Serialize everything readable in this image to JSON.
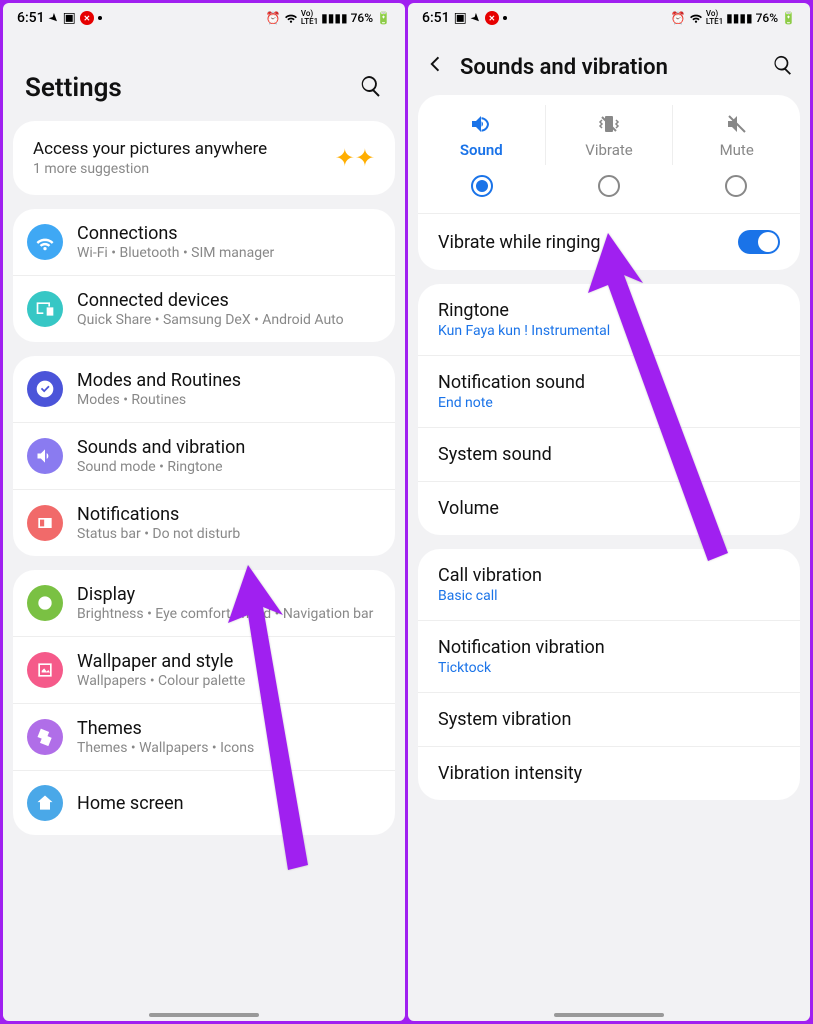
{
  "status": {
    "time": "6:51",
    "battery": "76%",
    "net": "LTE1",
    "vo": "VoLTE"
  },
  "left": {
    "title": "Settings",
    "suggest_title": "Access your pictures anywhere",
    "suggest_sub": "1 more suggestion",
    "groups": [
      [
        {
          "icon": "wifi",
          "bg": "#3fa8f4",
          "title": "Connections",
          "sub": "Wi-Fi  •  Bluetooth  •  SIM manager"
        },
        {
          "icon": "devices",
          "bg": "#37c7c5",
          "title": "Connected devices",
          "sub": "Quick Share  •  Samsung DeX  •  Android Auto"
        }
      ],
      [
        {
          "icon": "check",
          "bg": "#4b54d9",
          "title": "Modes and Routines",
          "sub": "Modes  •  Routines"
        },
        {
          "icon": "sound",
          "bg": "#8a7bf0",
          "title": "Sounds and vibration",
          "sub": "Sound mode  •  Ringtone"
        },
        {
          "icon": "notif",
          "bg": "#f16a6a",
          "title": "Notifications",
          "sub": "Status bar  •  Do not disturb"
        }
      ],
      [
        {
          "icon": "display",
          "bg": "#7ac143",
          "title": "Display",
          "sub": "Brightness  •  Eye comfort shield  •  Navigation bar"
        },
        {
          "icon": "wall",
          "bg": "#f55a8a",
          "title": "Wallpaper and style",
          "sub": "Wallpapers  •  Colour palette"
        },
        {
          "icon": "themes",
          "bg": "#b06ee8",
          "title": "Themes",
          "sub": "Themes  •  Wallpapers  •  Icons"
        },
        {
          "icon": "home",
          "bg": "#4aa8e8",
          "title": "Home screen",
          "sub": ""
        }
      ]
    ]
  },
  "right": {
    "title": "Sounds and vibration",
    "modes": [
      {
        "id": "sound",
        "label": "Sound",
        "selected": true
      },
      {
        "id": "vibrate",
        "label": "Vibrate",
        "selected": false
      },
      {
        "id": "mute",
        "label": "Mute",
        "selected": false
      }
    ],
    "vibrate_ringing": "Vibrate while ringing",
    "opts1": [
      {
        "title": "Ringtone",
        "sub": "Kun Faya kun ! Instrumental"
      },
      {
        "title": "Notification sound",
        "sub": "End note"
      },
      {
        "title": "System sound",
        "sub": ""
      },
      {
        "title": "Volume",
        "sub": ""
      }
    ],
    "opts2": [
      {
        "title": "Call vibration",
        "sub": "Basic call"
      },
      {
        "title": "Notification vibration",
        "sub": "Ticktock"
      },
      {
        "title": "System vibration",
        "sub": ""
      },
      {
        "title": "Vibration intensity",
        "sub": ""
      }
    ]
  }
}
